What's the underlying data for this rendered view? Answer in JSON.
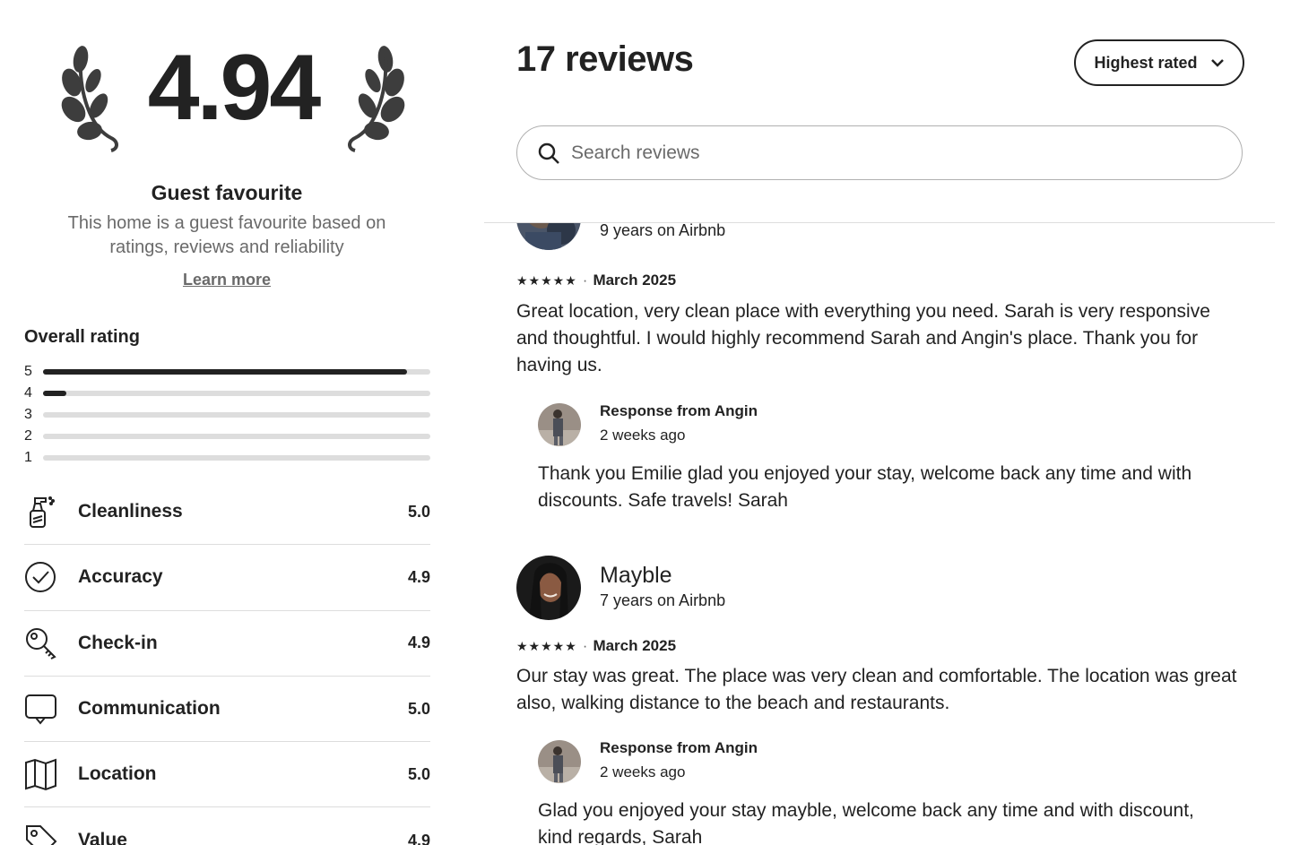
{
  "summary": {
    "rating": "4.94",
    "badge_title": "Guest favourite",
    "badge_desc": "This home is a guest favourite based on ratings, reviews and reliability",
    "learn_more": "Learn more"
  },
  "overall": {
    "label": "Overall rating",
    "bars": [
      {
        "stars": "5",
        "fraction": 0.94
      },
      {
        "stars": "4",
        "fraction": 0.06
      },
      {
        "stars": "3",
        "fraction": 0
      },
      {
        "stars": "2",
        "fraction": 0
      },
      {
        "stars": "1",
        "fraction": 0
      }
    ]
  },
  "categories": [
    {
      "icon": "spray-bottle-icon",
      "label": "Cleanliness",
      "value": "5.0"
    },
    {
      "icon": "check-circle-icon",
      "label": "Accuracy",
      "value": "4.9"
    },
    {
      "icon": "key-icon",
      "label": "Check-in",
      "value": "4.9"
    },
    {
      "icon": "speech-bubble-icon",
      "label": "Communication",
      "value": "5.0"
    },
    {
      "icon": "map-icon",
      "label": "Location",
      "value": "5.0"
    },
    {
      "icon": "tag-icon",
      "label": "Value",
      "value": "4.9"
    }
  ],
  "reviews_header": {
    "count_label": "17 reviews",
    "sort_label": "Highest rated",
    "search_placeholder": "Search reviews"
  },
  "reviews": [
    {
      "name": "",
      "tenure": "9 years on Airbnb",
      "stars": "★★★★★",
      "date": "March 2025",
      "text": "Great location, very clean place with everything you need. Sarah is very responsive and thoughtful. I would highly recommend Sarah and Angin's place. Thank you for having us.",
      "response": {
        "title": "Response from Angin",
        "when": "2 weeks ago",
        "text": "Thank you Emilie glad you enjoyed your stay, welcome back any time and with discounts. Safe travels! Sarah"
      }
    },
    {
      "name": "Mayble",
      "tenure": "7 years on Airbnb",
      "stars": "★★★★★",
      "date": "March 2025",
      "text": "Our stay was great. The place was very clean and comfortable. The location was great also, walking distance to the beach and restaurants.",
      "response": {
        "title": "Response from Angin",
        "when": "2 weeks ago",
        "text": "Glad you enjoyed your stay mayble, welcome back any time and with discount, kind regards, Sarah"
      }
    }
  ],
  "colors": {
    "text": "#222222",
    "muted": "#6a6a6a",
    "track": "#dddddd"
  }
}
